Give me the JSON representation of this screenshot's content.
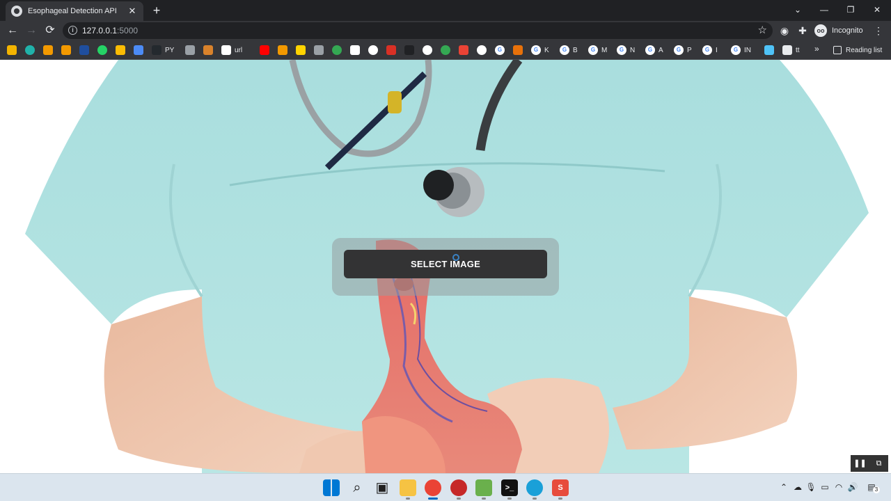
{
  "browser": {
    "tab_title": "Esophageal Detection API",
    "tab_close": "✕",
    "new_tab": "+",
    "url_host": "127.0.0.1",
    "url_port": ":5000",
    "profile_label": "Incognito",
    "window_controls": {
      "collapse": "⌄",
      "minimize": "—",
      "maximize": "❐",
      "close": "✕"
    },
    "nav": {
      "back": "←",
      "forward": "→",
      "reload": "⟳"
    }
  },
  "bookmarks": [
    {
      "icon": "bolt-icon",
      "color": "#f4b400",
      "label": ""
    },
    {
      "icon": "circle-g-icon",
      "color": "#20b2aa",
      "label": ""
    },
    {
      "icon": "lock-icon",
      "color": "#f29900",
      "label": ""
    },
    {
      "icon": "chart-icon",
      "color": "#f29900",
      "label": ""
    },
    {
      "icon": "ieee-icon",
      "color": "#1f4e9e",
      "label": ""
    },
    {
      "icon": "whatsapp-icon",
      "color": "#25d366",
      "label": ""
    },
    {
      "icon": "ads-icon",
      "color": "#fbbc04",
      "label": ""
    },
    {
      "icon": "triangle-icon",
      "color": "#4c8bf5",
      "label": ""
    },
    {
      "icon": "github-icon",
      "color": "#24292e",
      "label": "PY"
    },
    {
      "icon": "car-icon",
      "color": "#9aa0a6",
      "label": ""
    },
    {
      "icon": "m-icon",
      "color": "#d9822b",
      "label": ""
    },
    {
      "icon": "link-icon",
      "color": "#ffffff",
      "label": "url"
    },
    {
      "icon": "youtube-icon",
      "color": "#ff0000",
      "label": ""
    },
    {
      "icon": "tag-icon",
      "color": "#f29900",
      "label": ""
    },
    {
      "icon": "p-icon",
      "color": "#ffd400",
      "label": ""
    },
    {
      "icon": "glasses-icon",
      "color": "#9aa0a6",
      "label": ""
    },
    {
      "icon": "ring-icon",
      "color": "#34a853",
      "label": ""
    },
    {
      "icon": "doc-icon",
      "color": "#ffffff",
      "label": ""
    },
    {
      "icon": "globe-icon",
      "color": "#ffffff",
      "label": ""
    },
    {
      "icon": "heart-icon",
      "color": "#d93025",
      "label": ""
    },
    {
      "icon": "dl-icon",
      "color": "#202124",
      "label": ""
    },
    {
      "icon": "globe-icon",
      "color": "#ffffff",
      "label": ""
    },
    {
      "icon": "badge-icon",
      "color": "#34a853",
      "label": ""
    },
    {
      "icon": "mail-icon",
      "color": "#ea4335",
      "label": ""
    },
    {
      "icon": "globe-icon",
      "color": "#ffffff",
      "label": ""
    },
    {
      "icon": "google-icon",
      "color": "#ffffff",
      "label": ""
    },
    {
      "icon": "arrow-icon",
      "color": "#e8710a",
      "label": ""
    },
    {
      "icon": "google-icon",
      "color": "#ffffff",
      "label": "K"
    },
    {
      "icon": "google-icon",
      "color": "#ffffff",
      "label": "B"
    },
    {
      "icon": "google-icon",
      "color": "#ffffff",
      "label": "M"
    },
    {
      "icon": "google-icon",
      "color": "#ffffff",
      "label": "N"
    },
    {
      "icon": "google-icon",
      "color": "#ffffff",
      "label": "A"
    },
    {
      "icon": "google-icon",
      "color": "#ffffff",
      "label": "P"
    },
    {
      "icon": "google-icon",
      "color": "#ffffff",
      "label": "I"
    },
    {
      "icon": "google-icon",
      "color": "#ffffff",
      "label": "IN"
    },
    {
      "icon": "a-icon",
      "color": "#4fc3f7",
      "label": ""
    },
    {
      "icon": "monitor-icon",
      "color": "#e8eaed",
      "label": "tt"
    }
  ],
  "bookmarks_more": "»",
  "reading_list": "Reading list",
  "page": {
    "select_button_label": "SELECT IMAGE"
  },
  "pip_controls": {
    "pause": "❚❚",
    "screen": "⧉"
  },
  "taskbar": {
    "apps": [
      {
        "name": "start-icon",
        "color": "#0078d4"
      },
      {
        "name": "search-icon",
        "color": "#202020"
      },
      {
        "name": "task-view-icon",
        "color": "#202020"
      },
      {
        "name": "file-explorer-icon",
        "color": "#f6c343"
      },
      {
        "name": "chrome-icon",
        "color": "#ea4335"
      },
      {
        "name": "ladybug-icon",
        "color": "#c62828"
      },
      {
        "name": "notepad-icon",
        "color": "#6ab04c"
      },
      {
        "name": "terminal-icon",
        "color": "#111111"
      },
      {
        "name": "edge-icon",
        "color": "#1aa0d8"
      },
      {
        "name": "app-s-icon",
        "color": "#e74c3c"
      }
    ],
    "notification_count": "3"
  }
}
